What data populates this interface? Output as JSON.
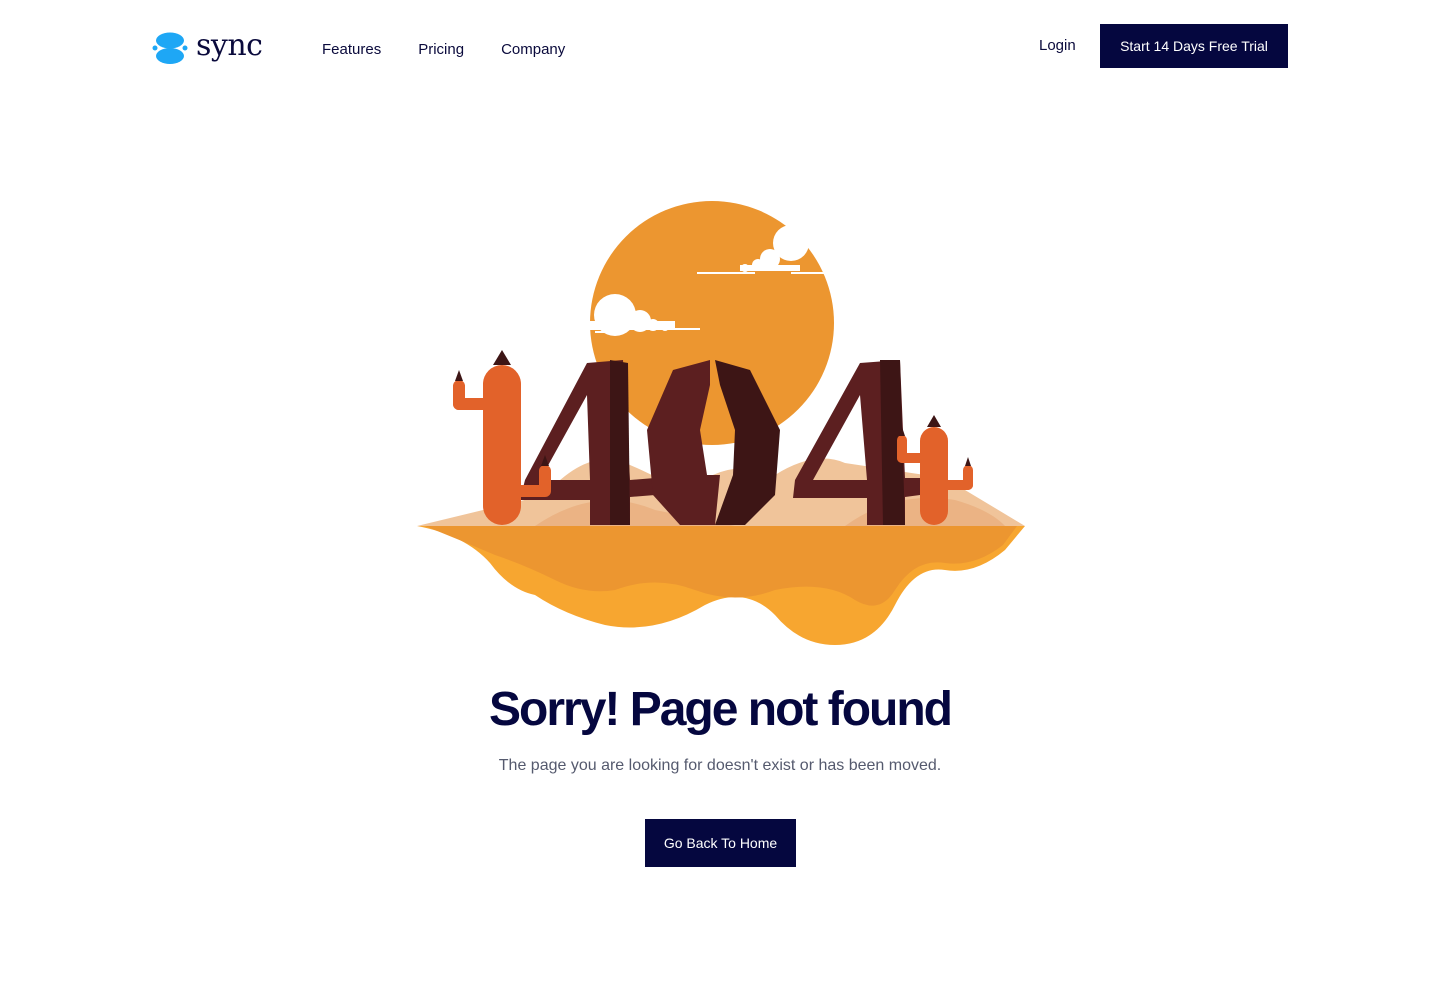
{
  "header": {
    "logo_text": "sync",
    "logo_icon": "sync-logo-icon",
    "nav": [
      "Features",
      "Pricing",
      "Company"
    ],
    "login_label": "Login",
    "cta_label": "Start 14 Days Free Trial"
  },
  "illustration": {
    "text": "404"
  },
  "main": {
    "title": "Sorry! Page not found",
    "subtitle": "The page you are looking for doesn't exist or has been moved.",
    "button_label": "Go Back To Home"
  },
  "colors": {
    "primary": "#05073f",
    "logo_blue": "#1ea7f5",
    "sun": "#ec9630",
    "sand_light": "#f0c49a",
    "sand_dark": "#f7a630",
    "cactus": "#e2622a",
    "letters": "#5c1f20"
  }
}
